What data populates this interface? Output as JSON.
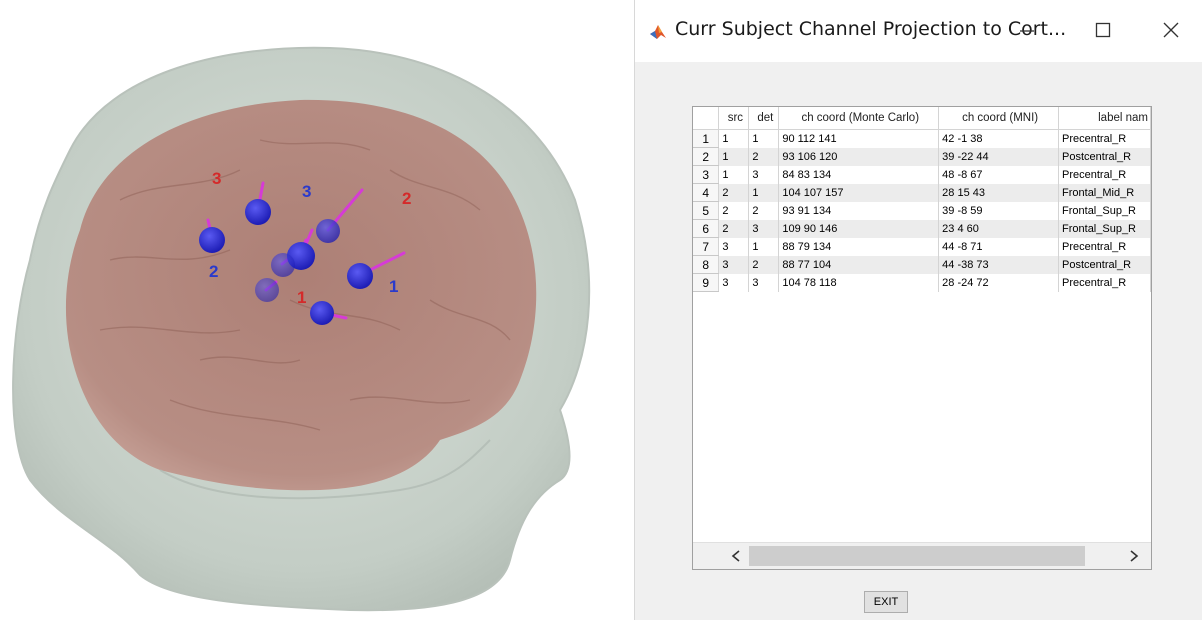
{
  "view3d": {
    "optode_labels": [
      {
        "text": "3",
        "kind": "source"
      },
      {
        "text": "3",
        "kind": "detector"
      },
      {
        "text": "2",
        "kind": "source"
      },
      {
        "text": "2",
        "kind": "detector"
      },
      {
        "text": "1",
        "kind": "source"
      },
      {
        "text": "1",
        "kind": "detector"
      }
    ],
    "colors": {
      "head": "#c9d3cb",
      "brain": "#a97a6f",
      "optode": "#2a2ad6",
      "projection_line": "#d63bd6",
      "source_label": "#d42a2a",
      "detector_label": "#2a3acc"
    }
  },
  "window": {
    "title": "Curr Subject Channel Projection to Cort...",
    "icon": "matlab-icon",
    "minimize_label": "—",
    "maximize_label": "☐",
    "close_label": "✕"
  },
  "table": {
    "columns": [
      "",
      "src",
      "det",
      "ch coord (Monte Carlo)",
      "ch coord (MNI)",
      "label nam"
    ],
    "rows": [
      {
        "n": "1",
        "src": "1",
        "det": "1",
        "mc": "90  112  141",
        "mni": "42  -1  38",
        "label": "Precentral_R"
      },
      {
        "n": "2",
        "src": "1",
        "det": "2",
        "mc": "93  106  120",
        "mni": "39 -22  44",
        "label": "Postcentral_R"
      },
      {
        "n": "3",
        "src": "1",
        "det": "3",
        "mc": "84  83  134",
        "mni": "48  -8  67",
        "label": "Precentral_R"
      },
      {
        "n": "4",
        "src": "2",
        "det": "1",
        "mc": "104  107  157",
        "mni": "28  15  43",
        "label": "Frontal_Mid_R"
      },
      {
        "n": "5",
        "src": "2",
        "det": "2",
        "mc": "93  91  134",
        "mni": "39  -8  59",
        "label": "Frontal_Sup_R"
      },
      {
        "n": "6",
        "src": "2",
        "det": "3",
        "mc": "109  90  146",
        "mni": "23  4  60",
        "label": "Frontal_Sup_R"
      },
      {
        "n": "7",
        "src": "3",
        "det": "1",
        "mc": "88  79  134",
        "mni": "44  -8  71",
        "label": "Precentral_R"
      },
      {
        "n": "8",
        "src": "3",
        "det": "2",
        "mc": "88  77  104",
        "mni": "44 -38  73",
        "label": "Postcentral_R"
      },
      {
        "n": "9",
        "src": "3",
        "det": "3",
        "mc": "104  78  118",
        "mni": "28 -24  72",
        "label": "Precentral_R"
      }
    ],
    "scroll_left_icon": "chevron-left-icon",
    "scroll_right_icon": "chevron-right-icon"
  },
  "exit_label": "EXIT"
}
